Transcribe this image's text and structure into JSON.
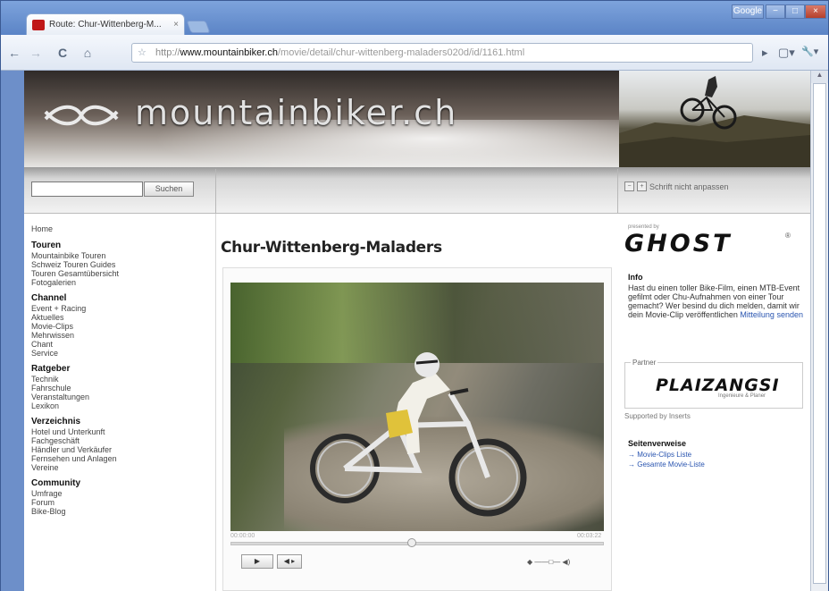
{
  "browser": {
    "tab_title": "Route: Chur-Wittenberg-M...",
    "tab_close": "×",
    "window_user": "Google",
    "window_min": "−",
    "window_max": "□",
    "window_close": "×",
    "url_prefix": "http://",
    "url_host": "www.mountainbiker.ch",
    "url_rest": "/movie/detail/chur-wittenberg-maladers020d/id/1161.html",
    "nav_back": "←",
    "nav_forward": "→",
    "nav_reload": "C",
    "nav_home": "⌂",
    "star": "☆",
    "tb_arrow": "▸",
    "tb_page": "▢▾",
    "tb_wrench": "🔧▾",
    "scroll_up": "▲"
  },
  "site": {
    "logo_text": "mountainbiker.ch",
    "search_placeholder": "",
    "search_button": "Suchen",
    "font_small": "−",
    "font_large": "+",
    "font_label": "Schrift nicht anpassen",
    "colors": {
      "accent_link": "#2a55b0",
      "brand_red": "#c01818"
    }
  },
  "nav": {
    "home": "Home",
    "sections": [
      {
        "title": "Touren",
        "items": [
          "Mountainbike Touren",
          "Schweiz Touren Guides",
          "Touren Gesamtübersicht",
          "Fotogalerien"
        ]
      },
      {
        "title": "Channel",
        "items": [
          "Event + Racing",
          "Aktuelles",
          "Movie-Clips",
          "Mehrwissen",
          "Chant",
          "Service"
        ]
      },
      {
        "title": "Ratgeber",
        "items": [
          "Technik",
          "Fahrschule",
          "Veranstaltungen",
          "Lexikon"
        ]
      },
      {
        "title": "Verzeichnis",
        "items": [
          "Hotel und Unterkunft",
          "Fachgeschäft",
          "Händler und Verkäufer",
          "Fernsehen und Anlagen",
          "Vereine"
        ]
      },
      {
        "title": "Community",
        "items": [
          "Umfrage",
          "Forum",
          "Bike-Blog"
        ]
      }
    ]
  },
  "main": {
    "title": "Chur-Wittenberg-Maladers",
    "player": {
      "time_elapsed": "00:00:00",
      "time_total": "00:03:22",
      "progress": 0.5,
      "play_label": "▶",
      "stop_label": "◀ ▸",
      "volume_label": "◆ ——□— ◀)"
    }
  },
  "sidebar": {
    "sponsor_small": "presented by",
    "sponsor_brand": "GHOST",
    "sponsor_reg": "®",
    "info_title": "Info",
    "info_text": "Hast du einen toller Bike-Film, einen MTB-Event gefilmt oder Chu-Aufnahmen von einer Tour gemacht? Wer besind du dich melden, damit wir dein Movie-Clip veröffentlichen",
    "info_link": "Mitteilung senden",
    "ad_label": "Partner",
    "ad_brand": "PLAIZANGSI",
    "ad_sub": "Ingenieure & Planer",
    "supported": "Supported by Inserts",
    "related_title": "Seitenverweise",
    "related_links": [
      "→ Movie-Clips Liste",
      "→ Gesamte Movie-Liste"
    ]
  }
}
